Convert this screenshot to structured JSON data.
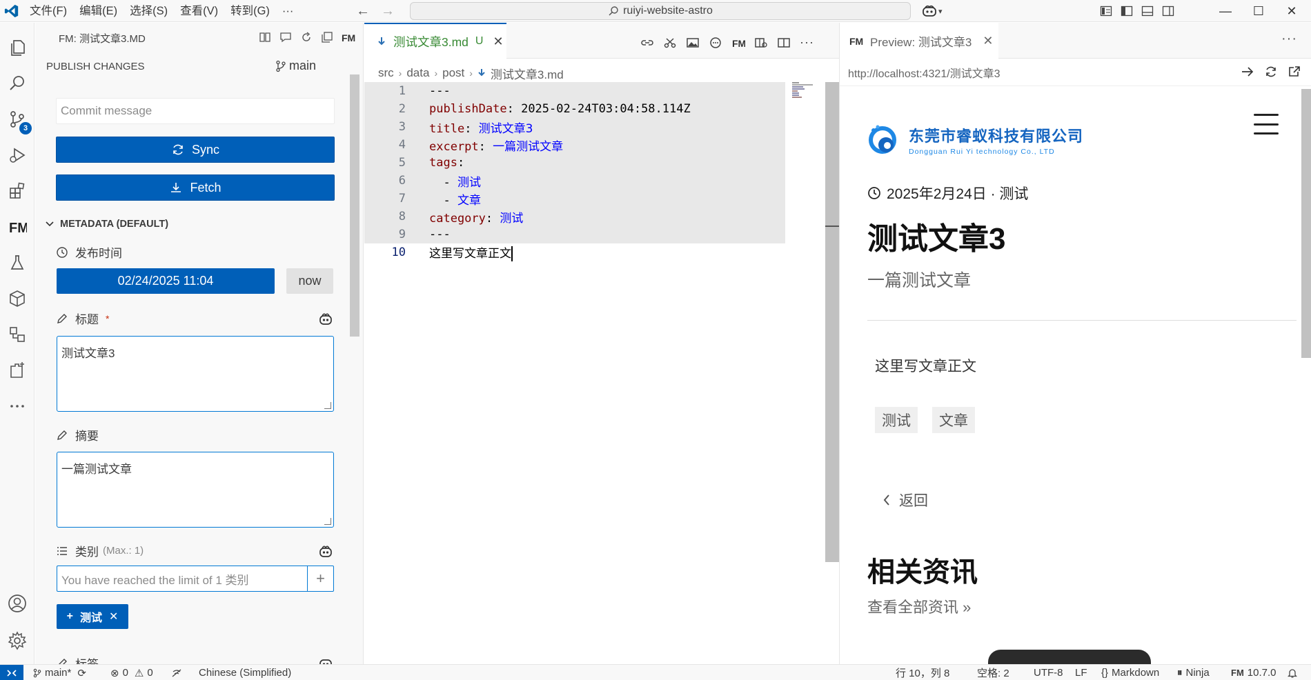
{
  "titlebar": {
    "menus": [
      "文件(F)",
      "编辑(E)",
      "选择(S)",
      "查看(V)",
      "转到(G)",
      "···"
    ],
    "search": "ruiyi-website-astro"
  },
  "activitybar": {
    "scm_badge": "3"
  },
  "sidebar": {
    "header_title": "FM: 测试文章3.MD",
    "publish_changes": "PUBLISH CHANGES",
    "branch": "main",
    "commit_placeholder": "Commit message",
    "sync_label": "Sync",
    "fetch_label": "Fetch",
    "metadata_title": "METADATA (DEFAULT)",
    "publish_date_label": "发布时间",
    "publish_date_value": "02/24/2025 11:04",
    "now_label": "now",
    "title_label": "标题",
    "required_mark": "*",
    "title_value": "测试文章3",
    "excerpt_label": "摘要",
    "excerpt_value": "一篇测试文章",
    "category_label": "类别",
    "category_hint": "(Max.: 1)",
    "category_placeholder": "You have reached the limit of 1 类别",
    "category_chip": "测试",
    "tags_label": "标签"
  },
  "editor": {
    "tab_name": "测试文章3.md",
    "tab_status": "U",
    "breadcrumb": [
      "src",
      "data",
      "post",
      "测试文章3.md"
    ],
    "lines": [
      {
        "n": "1",
        "key": "---",
        "val": ""
      },
      {
        "n": "2",
        "key": "publishDate",
        "val": "2025-02-24T03:04:58.114Z"
      },
      {
        "n": "3",
        "key": "title",
        "val": "测试文章3"
      },
      {
        "n": "4",
        "key": "excerpt",
        "val": "一篇测试文章"
      },
      {
        "n": "5",
        "key": "tags",
        "val": ""
      },
      {
        "n": "6",
        "key": "",
        "val": "测试"
      },
      {
        "n": "7",
        "key": "",
        "val": "文章"
      },
      {
        "n": "8",
        "key": "category",
        "val": "测试"
      },
      {
        "n": "9",
        "key": "---",
        "val": ""
      },
      {
        "n": "10",
        "key": "",
        "val": "这里写文章正文"
      }
    ]
  },
  "preview": {
    "tab_name": "Preview: 测试文章3",
    "url": "http://localhost:4321/测试文章3",
    "logo_cn": "东莞市睿蚁科技有限公司",
    "logo_en": "Dongguan Rui Yi technology Co., LTD",
    "post_meta": "2025年2月24日 · 测试",
    "post_title": "测试文章3",
    "post_excerpt": "一篇测试文章",
    "post_body": "这里写文章正文",
    "tags": [
      "测试",
      "文章"
    ],
    "back_label": "返回",
    "related_title": "相关资讯",
    "see_all": "查看全部资讯 »"
  },
  "statusbar": {
    "branch": "main*",
    "errors": "0",
    "warnings": "0",
    "language_pack": "Chinese (Simplified)",
    "position": "行 10，列 8",
    "spaces": "空格: 2",
    "encoding": "UTF-8",
    "eol": "LF",
    "mode": "Markdown",
    "template": "Ninja",
    "fm_version": "10.7.0"
  },
  "colors": {
    "accent": "#005fb8",
    "untracked": "#388a34",
    "yaml_key": "#800000",
    "yaml_value": "#0000ff"
  }
}
